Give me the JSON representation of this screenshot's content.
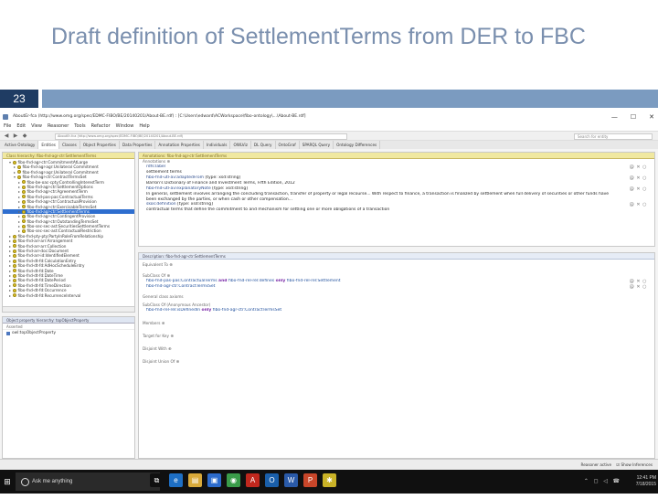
{
  "slide": {
    "title": "Draft definition of SettlementTerms from DER to FBC",
    "page_number": "23"
  },
  "window": {
    "title": "AboutEr-fca (http://www.omg.org/spec/EDMC-FIBO/BE/20140201/About-BE.rdf) : [C:\\Users\\edward\\ACWorkspace\\fibo-ontology\\...\\About-BE.rdf]",
    "minimize": "—",
    "maximize": "☐",
    "close": "✕"
  },
  "menu": [
    "File",
    "Edit",
    "View",
    "Reasoner",
    "Tools",
    "Refactor",
    "Window",
    "Help"
  ],
  "toolbar": {
    "address": "AboutEr-fca (http://www.omg.org/spec/EDMC-FIBO/BE/20140201/About-BE.rdf)",
    "search_placeholder": "Search for entity"
  },
  "tabs": [
    "Active Ontology",
    "Entities",
    "Classes",
    "Object Properties",
    "Data Properties",
    "Annotation Properties",
    "Individuals",
    "OWLViz",
    "DL Query",
    "OntoGraf",
    "SPARQL Query",
    "Ontology Differences"
  ],
  "active_tab_index": 1,
  "class_hierarchy": {
    "header": "Class hierarchy: fibo-fnd-agr-ctr:SettlementTerms",
    "items": [
      {
        "label": "fibo-fnd-agr-ctr:CommitmentAtLarge",
        "indent": 1,
        "expanded": true
      },
      {
        "label": "fibo-fnd-agr-agr:Unilateral Commitment",
        "indent": 2,
        "expanded": false
      },
      {
        "label": "fibo-fnd-agr-agr:Unilateral Commitment",
        "indent": 2,
        "expanded": false
      },
      {
        "label": "fibo-fnd-agr-ctr:ContractTermsSet",
        "indent": 2,
        "expanded": true
      },
      {
        "label": "fibo-be-oac-cpty:ControllingInterestTerm",
        "indent": 3,
        "expanded": false
      },
      {
        "label": "fibo-fnd-agr-ctr:SettlementOptions",
        "indent": 3,
        "expanded": false
      },
      {
        "label": "fibo-fnd-agr-ctr:AgreementTerm",
        "indent": 3,
        "expanded": false
      },
      {
        "label": "fibo-fnd-pas-pas:ContractualTerms",
        "indent": 3,
        "expanded": false
      },
      {
        "label": "fibo-fnd-agr-ctr:ContractualProvision",
        "indent": 3,
        "expanded": false
      },
      {
        "label": "fibo-fnd-agr-ctr:ExercisableTermsSet",
        "indent": 3,
        "expanded": false
      },
      {
        "label": "fibo-fnd-agr-ctr:SettlementTerms",
        "indent": 3,
        "expanded": false,
        "selected": true
      },
      {
        "label": "fibo-fnd-agr-ctr:ContingentProvision",
        "indent": 3,
        "expanded": false
      },
      {
        "label": "fibo-fnd-agr-ctr:OutstandingTermsSet",
        "indent": 3,
        "expanded": false
      },
      {
        "label": "fibo-sec-sec-ast:SecuritiesSettlementTerms",
        "indent": 3,
        "expanded": false
      },
      {
        "label": "fibo-sec-sec-ast:ContractualRestriction",
        "indent": 3,
        "expanded": false
      },
      {
        "label": "fibo-fnd-pty-pty:PartyInRoleFromRelationship",
        "indent": 1,
        "expanded": false
      },
      {
        "label": "fibo-fnd-arr-arr:Arrangement",
        "indent": 1,
        "expanded": false
      },
      {
        "label": "fibo-fnd-arr-arr:Collection",
        "indent": 1,
        "expanded": false
      },
      {
        "label": "fibo-fnd-arr-doc:Document",
        "indent": 1,
        "expanded": false
      },
      {
        "label": "fibo-fnd-arr-id:IdentifiedElement",
        "indent": 1,
        "expanded": false
      },
      {
        "label": "fibo-fnd-dt-fd:CalculationEntry",
        "indent": 1,
        "expanded": false
      },
      {
        "label": "fibo-fnd-dt-fd:AdHocScheduleEntry",
        "indent": 1,
        "expanded": false
      },
      {
        "label": "fibo-fnd-dt-fd:Date",
        "indent": 1,
        "expanded": false
      },
      {
        "label": "fibo-fnd-dt-fd:DateTime",
        "indent": 1,
        "expanded": false
      },
      {
        "label": "fibo-fnd-dt-fd:DatePeriod",
        "indent": 1,
        "expanded": false
      },
      {
        "label": "fibo-fnd-dt-fd:TimeDirection",
        "indent": 1,
        "expanded": false
      },
      {
        "label": "fibo-fnd-dt-fd:Occurrence",
        "indent": 1,
        "expanded": false
      },
      {
        "label": "fibo-fnd-dt-fd:RecurrenceInterval",
        "indent": 1,
        "expanded": false
      }
    ]
  },
  "object_property_hierarchy": {
    "header": "Object property hierarchy: topObjectProperty",
    "toolbar": "Asserted",
    "items": [
      "owl:topObjectProperty"
    ]
  },
  "annotations": {
    "header": "Annotations: fibo-fnd-agr-ctr:SettlementTerms",
    "section": "Annotations",
    "row1_label": "rdfs:label",
    "row1_value": "settlement terms",
    "row2_label": "fibo-fnd-utl-av:adaptedFrom",
    "row2_lang": "[type: xsd:string]",
    "row2_value": "Barron's Dictionary of Finance and Investment Terms, Fifth Edition, 2012",
    "row3_label": "fibo-fnd-utl-av:explanatoryNote",
    "row3_lang": "[type: xsd:string]",
    "row3_value": "In general, settlement involves arranging the concluding transaction, transfer of property or legal recourse... With respect to finance, a transaction is finalized by settlement when full delivery of securities or other funds have been exchanged by the parties, or when cash or other compensation...",
    "row4_label": "skos:definition",
    "row4_lang": "[type: xsd:string]",
    "row4_value": "contractual terms that define the commitment to and mechanism for settling one or more obligations of a transaction",
    "row_controls": "@ ✕ ○"
  },
  "description": {
    "header": "Description: fibo-fnd-agr-ctr:SettlementTerms",
    "equivalent_to": "Equivalent To",
    "subclass_of": "SubClass Of",
    "subclass_row1_class": "fibo-fnd-pas-pas:ContractualTerms",
    "subclass_row1_kw": "and",
    "subclass_row1_prop": "fibo-fnd-rel-rel:defines",
    "subclass_row1_kw2": "only",
    "subclass_row1_target": "fibo-fnd-rel-rel:Settlement",
    "subclass_row2_class": "fibo-fnd-agr-ctr:ContractTermsSet",
    "general_class_axioms": "General class axioms",
    "subclass_anon": "SubClass Of (Anonymous Ancestor)",
    "anon_row1_prop": "fibo-fnd-rel-rel:isDefinedIn",
    "anon_row1_kw": "only",
    "anon_row1_target": "fibo-fnd-agr-ctr:ContractTermsSet",
    "members": "Members",
    "target_for_key": "Target for Key",
    "disjoint_with": "Disjoint With",
    "disjoint_union_of": "Disjoint Union Of"
  },
  "status_bar": {
    "reasoner": "Reasoner active",
    "show_inferences": "☑ Show Inferences"
  },
  "taskbar": {
    "search_placeholder": "Ask me anything",
    "start_glyph": "⊞",
    "time": "12:41 PM",
    "date": "7/18/2015",
    "tray": "⌃ ◻ ◁ ☎",
    "icons": [
      {
        "name": "task-view-icon",
        "glyph": "⧉",
        "color": "#101010"
      },
      {
        "name": "edge-browser-icon",
        "glyph": "e",
        "color": "#1e6fc4"
      },
      {
        "name": "file-explorer-icon",
        "glyph": "▤",
        "color": "#d8a93a"
      },
      {
        "name": "store-icon",
        "glyph": "▣",
        "color": "#2c6bcb"
      },
      {
        "name": "chrome-icon",
        "glyph": "◉",
        "color": "#3a9c4a"
      },
      {
        "name": "acrobat-icon",
        "glyph": "A",
        "color": "#c0281e"
      },
      {
        "name": "outlook-icon",
        "glyph": "O",
        "color": "#1a5faa"
      },
      {
        "name": "word-icon",
        "glyph": "W",
        "color": "#2a5aa8"
      },
      {
        "name": "powerpoint-icon",
        "glyph": "P",
        "color": "#c8462a"
      },
      {
        "name": "protege-icon",
        "glyph": "✱",
        "color": "#c9b227"
      }
    ]
  },
  "colors": {
    "title_text": "#7a8fae",
    "page_number_bg": "#1f3c63",
    "strip_bg": "#7b9bc0",
    "selection": "#2e6ecf",
    "class_dot": "#e2c82e"
  }
}
